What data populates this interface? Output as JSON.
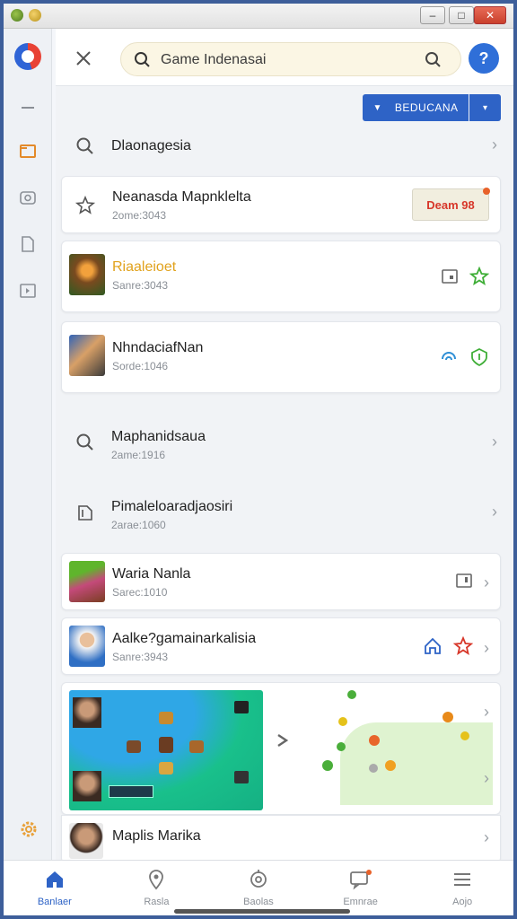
{
  "search": {
    "query": "Game Indenasai"
  },
  "filter": {
    "label": "BEDUCANA"
  },
  "rows": {
    "top": {
      "title": "Dlaonagesia"
    },
    "plain1": {
      "title": "Maphanidsaua",
      "sub": "2ame:1916"
    },
    "plain2": {
      "title": "Pimaleloaradjaosiri",
      "sub": "2arae:1060"
    }
  },
  "cards": [
    {
      "title": "Neanasda Mapnklelta",
      "sub": "2ome:3043",
      "badge": "Deam 98"
    },
    {
      "title": "Riaaleioet",
      "sub": "Sanre:3043",
      "title_color": "#e1a21c"
    },
    {
      "title": "NhndaciafNan",
      "sub": "Sorde:1046"
    },
    {
      "title": "Waria Nanla",
      "sub": "Sarec:1010"
    },
    {
      "title": "Aalke?gamainarkalisia",
      "sub": "Sanre:3943"
    },
    {
      "title": "Maplis Marika"
    }
  ],
  "nav": [
    {
      "label": "Banlaer",
      "icon": "home-icon",
      "active": true
    },
    {
      "label": "Rasla",
      "icon": "location-icon"
    },
    {
      "label": "Baolas",
      "icon": "target-icon"
    },
    {
      "label": "Emnrae",
      "icon": "message-icon"
    },
    {
      "label": "Aojo",
      "icon": "menu-icon"
    }
  ],
  "colors": {
    "accent": "#2e63c6",
    "window_border": "#3d5e9a",
    "star_green": "#3fae37",
    "star_red": "#d7372a"
  }
}
